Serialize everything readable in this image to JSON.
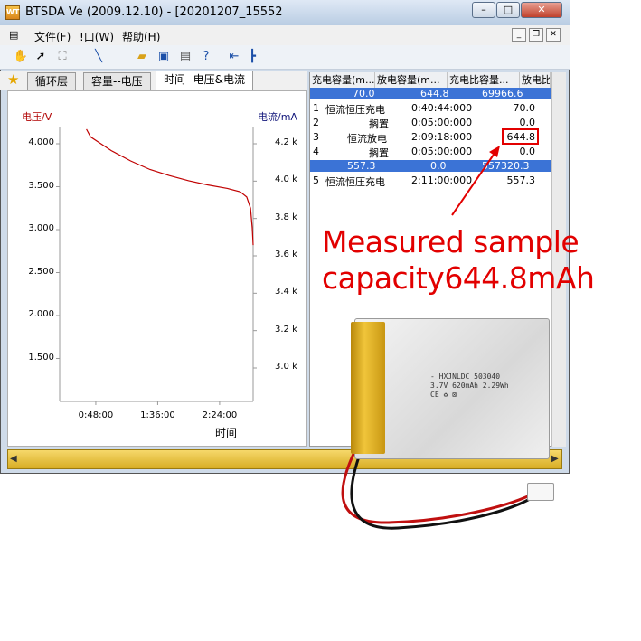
{
  "window": {
    "title": "BTSDA Ve (2009.12.10)    - [20201207_15552",
    "logo_text": "WT"
  },
  "menubar": {
    "items": [
      "文件(F)",
      "!口(W)",
      "帮助(H)"
    ]
  },
  "toolbar": {
    "icons": [
      "hand-icon",
      "pointer-icon",
      "zoom-region-icon",
      "pen-icon",
      "open-folder-icon",
      "save-icon",
      "print-icon",
      "help-icon",
      "go-start-icon",
      "marker-icon"
    ]
  },
  "tabs": {
    "items": [
      "循环层",
      "容量--电压",
      "时间--电压&电流"
    ],
    "active_index": 2
  },
  "chart": {
    "left_axis_title": "电压/V",
    "right_axis_title": "电流/mA",
    "x_title": "时间",
    "line_color": "#c00000"
  },
  "chart_data": {
    "type": "line",
    "title": "",
    "xlabel": "时间",
    "ylabel": "电压/V",
    "y2label": "电流/mA",
    "xlim": [
      "0:20:00",
      "2:50:00"
    ],
    "x_ticks": [
      "0:48:00",
      "1:36:00",
      "2:24:00"
    ],
    "ylim": [
      1.0,
      4.2
    ],
    "y_ticks": [
      "4.000",
      "3.500",
      "3.000",
      "2.500",
      "2.000",
      "1.500"
    ],
    "y2_ticks": [
      "4.2 k",
      "4.0 k",
      "3.8 k",
      "3.6 k",
      "3.4 k",
      "3.2 k",
      "3.0 k"
    ],
    "grid": false,
    "series": [
      {
        "x": [
          "0:40:44",
          "0:44:00",
          "0:50:00",
          "1:00:00",
          "1:15:00",
          "1:30:00",
          "1:45:00",
          "2:00:00",
          "2:15:00",
          "2:30:00",
          "2:40:00",
          "2:45:00",
          "2:48:00",
          "2:49:18",
          "2:50:00"
        ],
        "values": [
          4.17,
          4.08,
          4.02,
          3.92,
          3.8,
          3.7,
          3.63,
          3.57,
          3.52,
          3.48,
          3.44,
          3.38,
          3.25,
          3.02,
          2.82
        ]
      }
    ]
  },
  "table": {
    "headers": [
      "充电容量(m...",
      "放电容量(m...",
      "充电比容量...",
      "放电比容"
    ],
    "highlight_row_1": [
      "70.0",
      "644.8",
      "69966.6",
      ""
    ],
    "steps": [
      {
        "no": "1",
        "name": "恒流恒压充电",
        "time": "0:40:44:000",
        "value": "70.0"
      },
      {
        "no": "2",
        "name": "搁置",
        "time": "0:05:00:000",
        "value": "0.0"
      },
      {
        "no": "3",
        "name": "恒流放电",
        "time": "2:09:18:000",
        "value": "644.8"
      },
      {
        "no": "4",
        "name": "搁置",
        "time": "0:05:00:000",
        "value": "0.0"
      }
    ],
    "highlight_row_2": [
      "557.3",
      "0.0",
      "557320.3",
      ""
    ],
    "steps2": [
      {
        "no": "5",
        "name": "恒流恒压充电",
        "time": "2:11:00:000",
        "value": "557.3"
      }
    ]
  },
  "annotation": {
    "line1": "Measured sample",
    "line2": "capacity644.8mAh",
    "color": "#e20000"
  },
  "battery": {
    "label_lines": [
      "- HXJNLDC 503040",
      "3.7V 620mAh 2.29Wh",
      "CE  ♻  ⊠"
    ]
  }
}
